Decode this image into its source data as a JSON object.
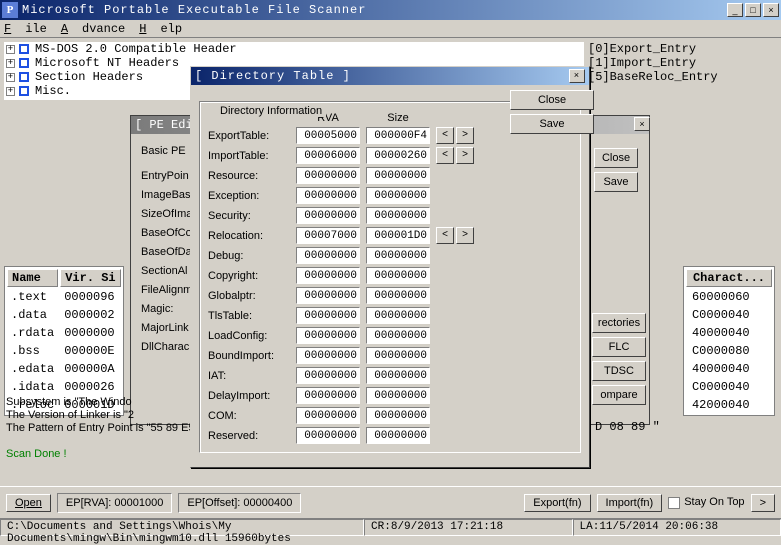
{
  "title": "Microsoft Portable Executable File Scanner",
  "menu": {
    "file": "File",
    "advance": "Advance",
    "help": "Help"
  },
  "tree": [
    "MS-DOS 2.0 Compatible Header",
    "Microsoft NT Headers",
    "Section Headers",
    "Misc."
  ],
  "right_list": [
    "[0]Export_Entry",
    "[1]Import_Entry",
    "[5]BaseReloc_Entry"
  ],
  "sections": {
    "headers": {
      "name": "Name",
      "vsize": "Vir. Si"
    },
    "rows": [
      {
        "name": ".text",
        "vsize": "0000096"
      },
      {
        "name": ".data",
        "vsize": "0000002"
      },
      {
        "name": ".rdata",
        "vsize": "0000000"
      },
      {
        "name": ".bss",
        "vsize": "000000E"
      },
      {
        "name": ".edata",
        "vsize": "000000A"
      },
      {
        "name": ".idata",
        "vsize": "0000026"
      },
      {
        "name": ".reloc",
        "vsize": "000001D"
      }
    ]
  },
  "charact": {
    "header": "Charact...",
    "rows": [
      "60000060",
      "C0000040",
      "40000040",
      "C0000080",
      "40000040",
      "C0000040",
      "42000040"
    ]
  },
  "info": {
    "line1": "Subsystem is \"The Windo",
    "line2": "The Version of Linker is \"2",
    "line3": "The Pattern of Entry Point is \"55 89 E5"
  },
  "scan_done": "Scan Done !",
  "pe_editor": {
    "title": "[ PE Editor",
    "group": "Basic PE",
    "labels": [
      "EntryPoin",
      "ImageBas",
      "SizeOfIma",
      "BaseOfCo",
      "BaseOfDa",
      "SectionAl",
      "FileAlignm",
      "Magic:",
      "MajorLink",
      "DllCharac"
    ],
    "close": "Close",
    "save": "Save"
  },
  "right_pe_btns": {
    "directories": "rectories",
    "flc": "FLC",
    "tdsc": "TDSC",
    "compare": "ompare"
  },
  "cr_line": "D 08 89 \"",
  "dlg": {
    "title": "[ Directory Table ]",
    "group": "Directory Information",
    "col_rva": "RVA",
    "col_size": "Size",
    "close": "Close",
    "save": "Save",
    "rows": [
      {
        "label": "ExportTable:",
        "rva": "00005000",
        "size": "000000F4",
        "arrows": true
      },
      {
        "label": "ImportTable:",
        "rva": "00006000",
        "size": "00000260",
        "arrows": true
      },
      {
        "label": "Resource:",
        "rva": "00000000",
        "size": "00000000"
      },
      {
        "label": "Exception:",
        "rva": "00000000",
        "size": "00000000"
      },
      {
        "label": "Security:",
        "rva": "00000000",
        "size": "00000000"
      },
      {
        "label": "Relocation:",
        "rva": "00007000",
        "size": "000001D0",
        "arrows": true
      },
      {
        "label": "Debug:",
        "rva": "00000000",
        "size": "00000000"
      },
      {
        "label": "Copyright:",
        "rva": "00000000",
        "size": "00000000"
      },
      {
        "label": "Globalptr:",
        "rva": "00000000",
        "size": "00000000"
      },
      {
        "label": "TlsTable:",
        "rva": "00000000",
        "size": "00000000"
      },
      {
        "label": "LoadConfig:",
        "rva": "00000000",
        "size": "00000000"
      },
      {
        "label": "BoundImport:",
        "rva": "00000000",
        "size": "00000000"
      },
      {
        "label": "IAT:",
        "rva": "00000000",
        "size": "00000000"
      },
      {
        "label": "DelayImport:",
        "rva": "00000000",
        "size": "00000000"
      },
      {
        "label": "COM:",
        "rva": "00000000",
        "size": "00000000"
      },
      {
        "label": "Reserved:",
        "rva": "00000000",
        "size": "00000000"
      }
    ]
  },
  "bottom": {
    "open": "Open",
    "ep_rva": "EP[RVA]: 00001000",
    "ep_off": "EP[Offset]: 00000400",
    "export_fn": "Export(fn)",
    "import_fn": "Import(fn)",
    "stay": "Stay On Top",
    "next": ">"
  },
  "status": {
    "path": "C:\\Documents and Settings\\Whois\\My Documents\\mingw\\Bin\\mingwm10.dll 15960bytes",
    "cr": "CR:8/9/2013 17:21:18",
    "la": "LA:11/5/2014 20:06:38"
  }
}
